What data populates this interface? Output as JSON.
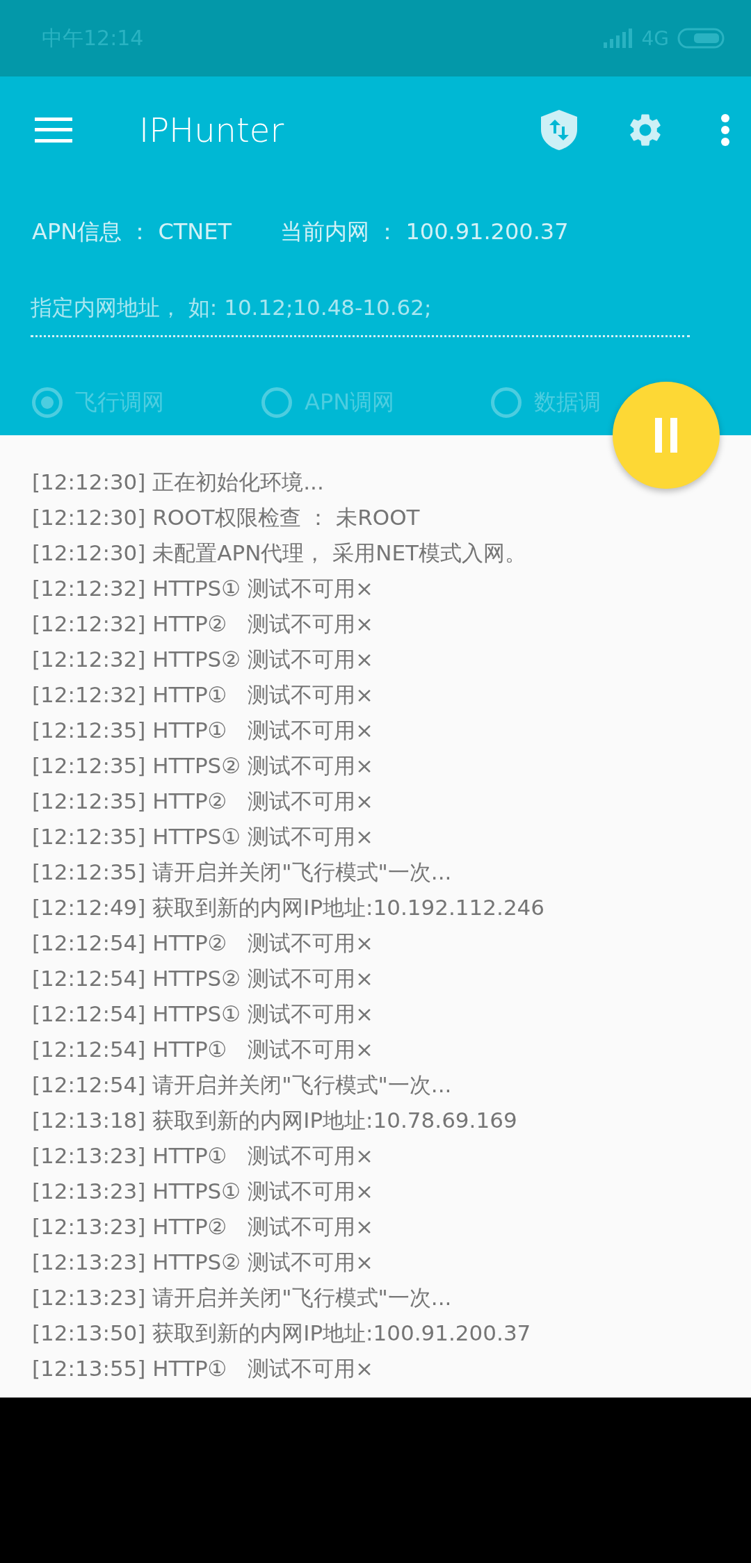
{
  "status_bar": {
    "time": "中午12:14",
    "network": "4G"
  },
  "toolbar": {
    "title": "IPHunter"
  },
  "info": {
    "apn": "APN信息 ： CTNET",
    "intranet": "当前内网 ： 100.91.200.37"
  },
  "address_field": {
    "placeholder": "指定内网地址， 如: 10.12;10.48-10.62;"
  },
  "modes": [
    {
      "label": "飞行调网",
      "selected": true
    },
    {
      "label": "APN调网",
      "selected": false
    },
    {
      "label": "数据调",
      "selected": false
    }
  ],
  "fab": {
    "kind": "pause"
  },
  "log": [
    "[12:12:30] 正在初始化环境...",
    "[12:12:30] ROOT权限检查 ： 未ROOT",
    "[12:12:30] 未配置APN代理， 采用NET模式入网。",
    "[12:12:32] HTTPS① 测试不可用×",
    "[12:12:32] HTTP②   测试不可用×",
    "[12:12:32] HTTPS② 测试不可用×",
    "[12:12:32] HTTP①   测试不可用×",
    "[12:12:35] HTTP①   测试不可用×",
    "[12:12:35] HTTPS② 测试不可用×",
    "[12:12:35] HTTP②   测试不可用×",
    "[12:12:35] HTTPS① 测试不可用×",
    "[12:12:35] 请开启并关闭\"飞行模式\"一次...",
    "[12:12:49] 获取到新的内网IP地址:10.192.112.246",
    "[12:12:54] HTTP②   测试不可用×",
    "[12:12:54] HTTPS② 测试不可用×",
    "[12:12:54] HTTPS① 测试不可用×",
    "[12:12:54] HTTP①   测试不可用×",
    "[12:12:54] 请开启并关闭\"飞行模式\"一次...",
    "[12:13:18] 获取到新的内网IP地址:10.78.69.169",
    "[12:13:23] HTTP①   测试不可用×",
    "[12:13:23] HTTPS① 测试不可用×",
    "[12:13:23] HTTP②   测试不可用×",
    "[12:13:23] HTTPS② 测试不可用×",
    "[12:13:23] 请开启并关闭\"飞行模式\"一次...",
    "[12:13:50] 获取到新的内网IP地址:100.91.200.37",
    "[12:13:55] HTTP①   测试不可用×"
  ]
}
